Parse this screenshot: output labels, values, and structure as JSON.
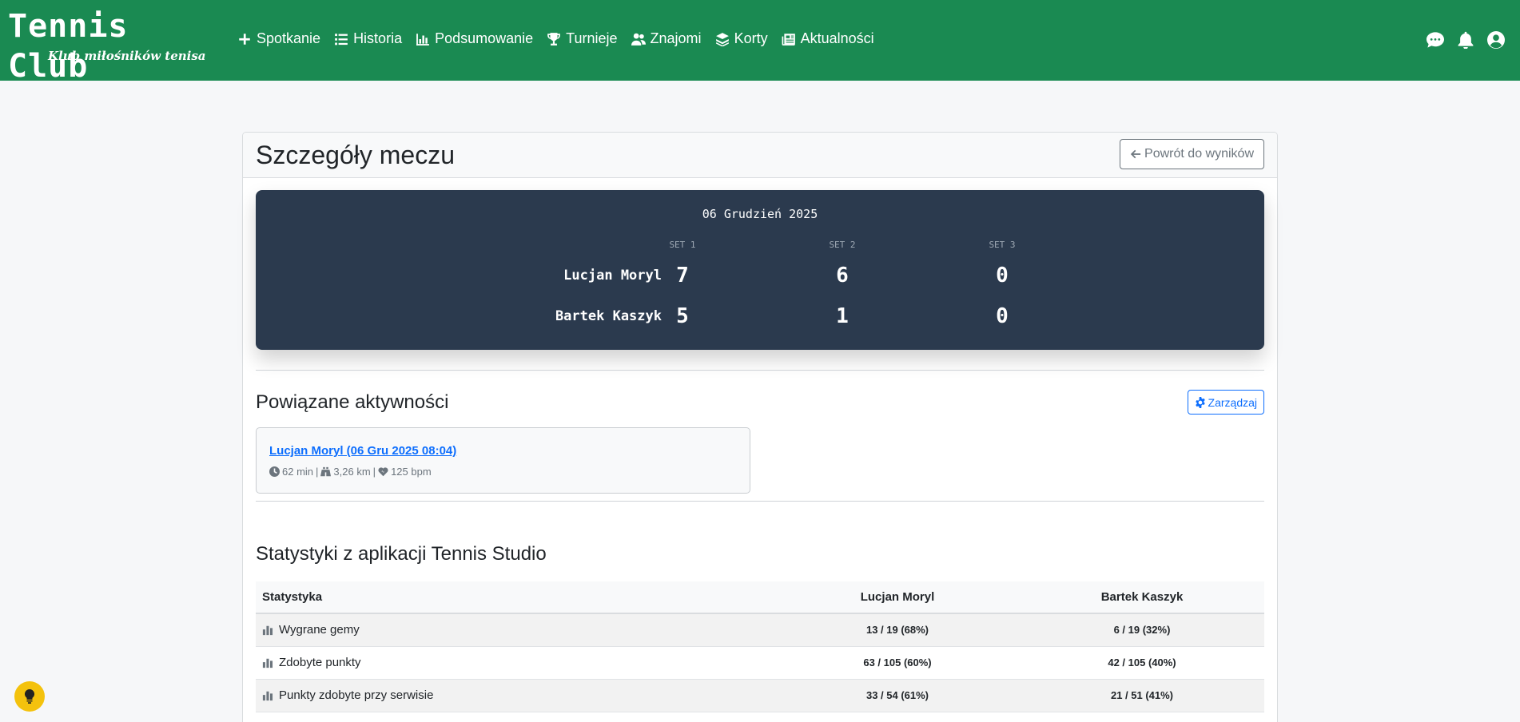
{
  "brand": {
    "title": "Tennis Club",
    "subtitle": "Klub miłośników tenisa"
  },
  "nav": [
    {
      "label": "Spotkanie",
      "icon": "plus-icon"
    },
    {
      "label": "Historia",
      "icon": "list-icon"
    },
    {
      "label": "Podsumowanie",
      "icon": "bar-chart-icon"
    },
    {
      "label": "Turnieje",
      "icon": "trophy-icon"
    },
    {
      "label": "Znajomi",
      "icon": "users-icon"
    },
    {
      "label": "Korty",
      "icon": "layers-icon"
    },
    {
      "label": "Aktualności",
      "icon": "newspaper-icon"
    }
  ],
  "page": {
    "title": "Szczegóły meczu",
    "back_label": "Powrót do wyników"
  },
  "match": {
    "date": "06 Grudzień 2025",
    "sets": [
      "SET 1",
      "SET 2",
      "SET 3"
    ],
    "players": [
      {
        "name": "Lucjan Moryl",
        "scores": [
          "7",
          "6",
          "0"
        ]
      },
      {
        "name": "Bartek Kaszyk",
        "scores": [
          "5",
          "1",
          "0"
        ]
      }
    ]
  },
  "activities": {
    "title": "Powiązane aktywności",
    "manage_label": "Zarządzaj",
    "item": {
      "link": "Lucjan Moryl (06 Gru 2025 08:04)",
      "duration": "62 min",
      "distance": "3,26 km",
      "heart_rate": "125 bpm",
      "separator": "|"
    }
  },
  "stats": {
    "title": "Statystyki z aplikacji Tennis Studio",
    "headers": [
      "Statystyka",
      "Lucjan Moryl",
      "Bartek Kaszyk"
    ],
    "rows": [
      {
        "label": "Wygrane gemy",
        "p1": "13 / 19 (68%)",
        "p2": "6 / 19 (32%)"
      },
      {
        "label": "Zdobyte punkty",
        "p1": "63 / 105 (60%)",
        "p2": "42 / 105 (40%)"
      },
      {
        "label": "Punkty zdobyte przy serwisie",
        "p1": "33 / 54 (61%)",
        "p2": "21 / 51 (41%)"
      }
    ]
  },
  "colors": {
    "navbar": "#1a8a52",
    "scoreboard": "#2b3a4e",
    "link": "#0d6efd",
    "bulb": "#f4c20d"
  }
}
